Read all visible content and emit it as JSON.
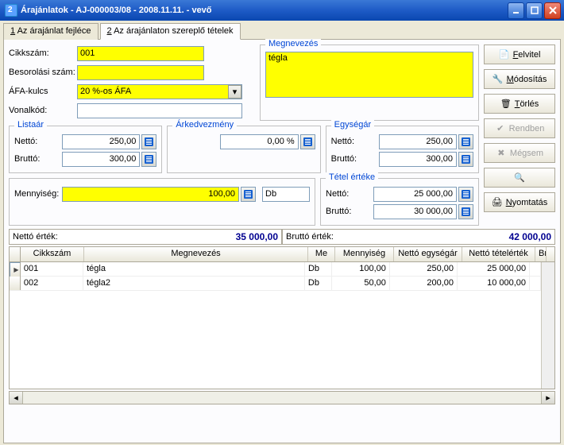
{
  "window": {
    "title": "Árajánlatok  -  AJ-000003/08  -  2008.11.11.  -  vevő"
  },
  "tabs": {
    "t1_num": "1",
    "t1_label": " Az árajánlat fejléce",
    "t2_num": "2",
    "t2_label": " Az árajánlaton szereplő tételek"
  },
  "fields": {
    "cikkszam_label": "Cikkszám:",
    "cikkszam": "001",
    "besorolasi_label": "Besorolási szám:",
    "afa_label": "ÁFA-kulcs",
    "afa": "20 %-os ÁFA",
    "vonalkod_label": "Vonalkód:",
    "megnevezes_label": "Megnevezés",
    "megnevezes": "tégla"
  },
  "listaar": {
    "title": "Listaár",
    "netto_label": "Nettó:",
    "netto": "250,00",
    "brutto_label": "Bruttó:",
    "brutto": "300,00"
  },
  "arkedv": {
    "title": "Árkedvezmény",
    "value": "0,00 %"
  },
  "egysegar": {
    "title": "Egységár",
    "netto_label": "Nettó:",
    "netto": "250,00",
    "brutto_label": "Bruttó:",
    "brutto": "300,00"
  },
  "mennyiseg": {
    "label": "Mennyiség:",
    "value": "100,00",
    "unit": "Db"
  },
  "tetel": {
    "title": "Tétel értéke",
    "netto_label": "Nettó:",
    "netto": "25 000,00",
    "brutto_label": "Bruttó:",
    "brutto": "30 000,00"
  },
  "totals": {
    "netto_label": "Nettó érték:",
    "netto": "35 000,00",
    "brutto_label": "Bruttó érték:",
    "brutto": "42 000,00"
  },
  "grid": {
    "headers": {
      "cikkszam": "Cikkszám",
      "megnevezes": "Megnevezés",
      "me": "Me",
      "mennyiseg": "Mennyiség",
      "egysegar": "Nettó egységár",
      "tetelertek": "Nettó tételérték",
      "brutto": "Br"
    },
    "rows": [
      {
        "cikkszam": "001",
        "megnevezes": "tégla",
        "me": "Db",
        "mennyiseg": "100,00",
        "egysegar": "250,00",
        "tetelertek": "25 000,00"
      },
      {
        "cikkszam": "002",
        "megnevezes": "tégla2",
        "me": "Db",
        "mennyiseg": "50,00",
        "egysegar": "200,00",
        "tetelertek": "10 000,00"
      }
    ]
  },
  "buttons": {
    "felvitel": "Felvitel",
    "modositas": "Módosítás",
    "torles": "Törlés",
    "rendben": "Rendben",
    "megsem": "Mégsem",
    "nyomtatas": "Nyomtatás"
  }
}
